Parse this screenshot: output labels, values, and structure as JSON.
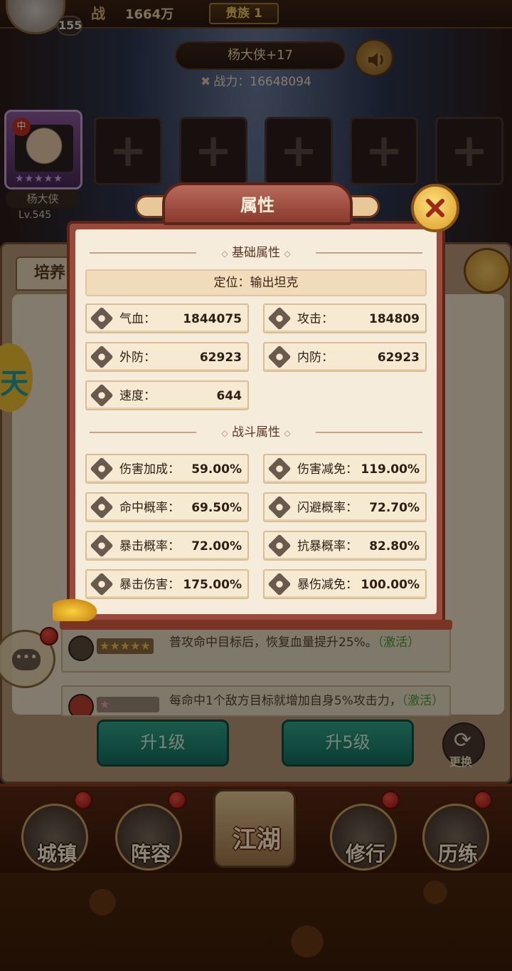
{
  "top_bar": {
    "level": "155",
    "zhan_label": "战",
    "power": "1664万",
    "noble": "贵族 1"
  },
  "hero_header": {
    "name": "杨大侠+17",
    "combat_label": "战力：",
    "combat_value": "16648094"
  },
  "hero_card": {
    "tag": "中",
    "stars": "★★★★★",
    "name": "杨大侠",
    "level": "Lv.545"
  },
  "slots": [
    "+",
    "+",
    "+",
    "+",
    "+"
  ],
  "under_panel": {
    "tab": "培养",
    "skills": [
      {
        "stars": "★★★★★",
        "text": "普攻命中目标后，恢复血量提升25%。",
        "activate": "（激活）"
      },
      {
        "stars": "★",
        "text": "每命中1个敌方目标就增加自身5%攻击力，",
        "activate": "（激活）"
      }
    ],
    "buttons": {
      "up1": "升1级",
      "up5": "升5级",
      "swap": "更换"
    }
  },
  "bottom_nav": {
    "items": [
      "城镇",
      "阵容",
      "江湖",
      "修行",
      "历练"
    ]
  },
  "modal": {
    "title": "属性",
    "basic_section": "基础属性",
    "role_label": "定位：",
    "role_value": "输出坦克",
    "basic_stats": [
      {
        "name": "气血：",
        "value": "1844075",
        "icon": "heart-icon"
      },
      {
        "name": "攻击：",
        "value": "184809",
        "icon": "sword-icon"
      },
      {
        "name": "外防：",
        "value": "62923",
        "icon": "shield-icon"
      },
      {
        "name": "内防：",
        "value": "62923",
        "icon": "flame-icon"
      },
      {
        "name": "速度：",
        "value": "644",
        "icon": "speed-icon"
      }
    ],
    "combat_section": "战斗属性",
    "combat_stats": [
      {
        "name": "伤害加成：",
        "value": "59.00%",
        "icon": "damage-up-icon"
      },
      {
        "name": "伤害减免：",
        "value": "119.00%",
        "icon": "skull-icon"
      },
      {
        "name": "命中概率：",
        "value": "69.50%",
        "icon": "target-icon"
      },
      {
        "name": "闪避概率：",
        "value": "72.70%",
        "icon": "dodge-icon"
      },
      {
        "name": "暴击概率：",
        "value": "72.00%",
        "icon": "crit-icon"
      },
      {
        "name": "抗暴概率：",
        "value": "82.80%",
        "icon": "crit-resist-icon"
      },
      {
        "name": "暴击伤害：",
        "value": "175.00%",
        "icon": "crit-damage-icon"
      },
      {
        "name": "暴伤减免：",
        "value": "100.00%",
        "icon": "crit-reduce-icon"
      }
    ]
  }
}
